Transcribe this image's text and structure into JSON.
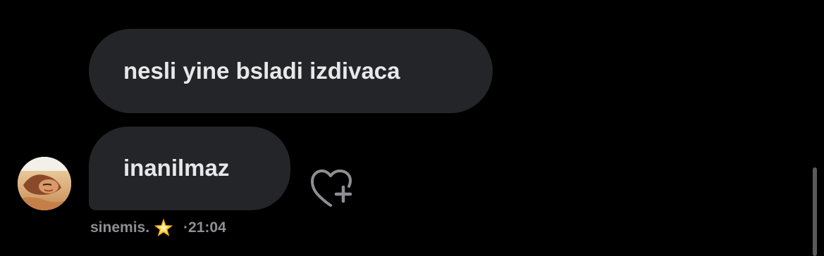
{
  "messages": [
    {
      "text": "nesli yine bsladi izdivaca"
    },
    {
      "text": "inanilmaz"
    }
  ],
  "sender": {
    "name": "sinemis.",
    "emoji": "🌟",
    "time": "·21:04"
  },
  "icons": {
    "react": "heart-plus-icon",
    "emoji": "glowing-star-icon"
  },
  "colors": {
    "background": "#000000",
    "bubble": "#242528",
    "bubble_text": "#e8e8ea",
    "meta_text": "#8e8e93"
  }
}
